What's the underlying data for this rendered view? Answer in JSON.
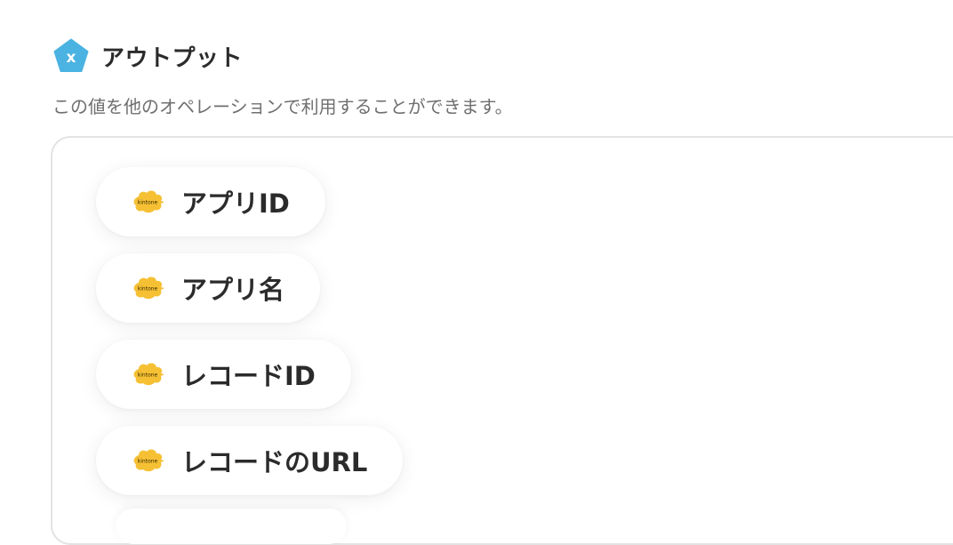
{
  "header": {
    "title": "アウトプット",
    "icon": "variable-x-icon",
    "icon_color": "#4ab3e2"
  },
  "subtitle": "この値を他のオペレーションで利用することができます。",
  "outputs": [
    {
      "label": "アプリID",
      "icon": "kintone-logo-icon",
      "logo_text": "kintone"
    },
    {
      "label": "アプリ名",
      "icon": "kintone-logo-icon",
      "logo_text": "kintone"
    },
    {
      "label": "レコードID",
      "icon": "kintone-logo-icon",
      "logo_text": "kintone"
    },
    {
      "label": "レコードのURL",
      "icon": "kintone-logo-icon",
      "logo_text": "kintone"
    }
  ],
  "colors": {
    "accent": "#4ab3e2",
    "kintone_yellow": "#f5c033",
    "text": "#2b2b2b",
    "muted": "#6f6f6f",
    "border": "#e3e3e3"
  }
}
